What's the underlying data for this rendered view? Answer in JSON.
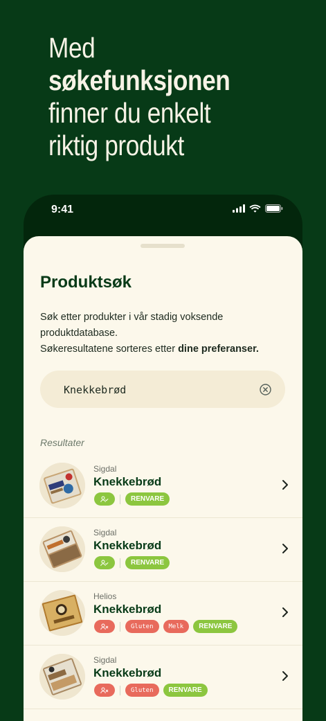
{
  "headline": {
    "line1_regular": "Med ",
    "line1_bold": "søkefunksjonen",
    "line2": "finner du enkelt",
    "line3": "riktig produkt"
  },
  "status_bar": {
    "time": "9:41"
  },
  "page": {
    "title": "Produktsøk",
    "desc_line1": "Søk etter produkter i vår stadig voksende produktdatabase.",
    "desc_line2_regular": "Søkeresultatene sorteres etter ",
    "desc_line2_bold": "dine preferanser."
  },
  "search": {
    "value": "Knekkebrød"
  },
  "results_label": "Resultater",
  "results": [
    {
      "brand": "Sigdal",
      "name": "Knekkebrød",
      "user_status": "ok",
      "allergens": [],
      "tag": "RENVARE"
    },
    {
      "brand": "Sigdal",
      "name": "Knekkebrød",
      "user_status": "ok",
      "allergens": [],
      "tag": "RENVARE"
    },
    {
      "brand": "Helios",
      "name": "Knekkebrød",
      "user_status": "warn",
      "allergens": [
        "Gluten",
        "Melk"
      ],
      "tag": "RENVARE"
    },
    {
      "brand": "Sigdal",
      "name": "Knekkebrød",
      "user_status": "warn",
      "allergens": [
        "Gluten"
      ],
      "tag": "RENVARE"
    }
  ],
  "colors": {
    "background": "#073a17",
    "sheet": "#fcf8eb",
    "tag_green": "#8cc63f",
    "tag_red": "#e86a5c",
    "primary_text": "#073a17"
  },
  "icons": {
    "clear": "clear-circle-icon",
    "chevron": "chevron-right-icon",
    "user_ok": "user-check-icon",
    "user_warn": "user-x-icon"
  }
}
